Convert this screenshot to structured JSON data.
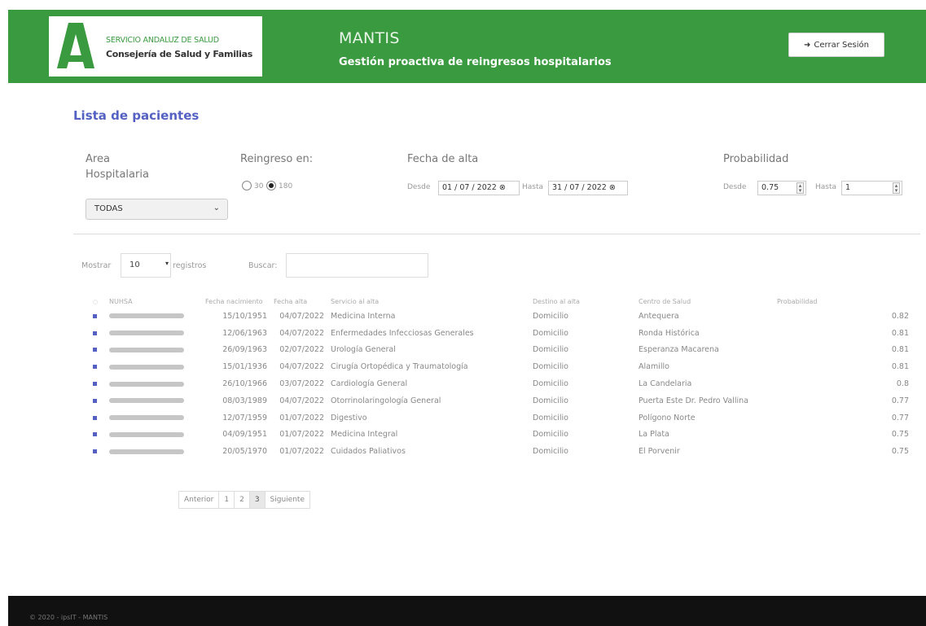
{
  "header": {
    "logo_line1": "SERVICIO ANDALUZ DE SALUD",
    "logo_line2": "Consejería de Salud y Familias",
    "app_title": "MANTIS",
    "app_subtitle": "Gestión proactiva de reingresos hospitalarios",
    "logout_label": "Cerrar Sesión",
    "brand_color": "#3a9a3f"
  },
  "page_title": "Lista de pacientes",
  "filters": {
    "area_label_1": "Area",
    "area_label_2": "Hospitalaria",
    "area_value": "TODAS",
    "reingreso_label": "Reingreso en:",
    "radio_30": "30",
    "radio_180": "180",
    "fecha_label": "Fecha de alta",
    "desde_label": "Desde",
    "desde_value": "01 / 07 / 2022",
    "hasta_label": "Hasta",
    "hasta_value": "31 / 07 / 2022",
    "prob_label": "Probabilidad",
    "prob_desde_label": "Desde",
    "prob_desde_value": "0.75",
    "prob_hasta_label": "Hasta",
    "prob_hasta_value": "1"
  },
  "table_controls": {
    "mostrar": "Mostrar",
    "length_value": "10",
    "registros": "registros",
    "buscar": "Buscar:"
  },
  "table": {
    "headers": [
      "NUHSA",
      "Fecha nacimiento",
      "Fecha alta",
      "Servicio al alta",
      "Destino al alta",
      "Centro de Salud",
      "Probabilidad"
    ],
    "rows": [
      {
        "nacimiento": "15/10/1951",
        "alta": "04/07/2022",
        "servicio": "Medicina Interna",
        "destino": "Domicilio",
        "centro": "Antequera",
        "prob": "0.82"
      },
      {
        "nacimiento": "12/06/1963",
        "alta": "04/07/2022",
        "servicio": "Enfermedades Infecciosas Generales",
        "destino": "Domicilio",
        "centro": "Ronda Histórica",
        "prob": "0.81"
      },
      {
        "nacimiento": "26/09/1963",
        "alta": "02/07/2022",
        "servicio": "Urología General",
        "destino": "Domicilio",
        "centro": "Esperanza Macarena",
        "prob": "0.81"
      },
      {
        "nacimiento": "15/01/1936",
        "alta": "04/07/2022",
        "servicio": "Cirugía Ortopédica y Traumatología",
        "destino": "Domicilio",
        "centro": "Alamillo",
        "prob": "0.81"
      },
      {
        "nacimiento": "26/10/1966",
        "alta": "03/07/2022",
        "servicio": "Cardiología General",
        "destino": "Domicilio",
        "centro": "La Candelaria",
        "prob": "0.8"
      },
      {
        "nacimiento": "08/03/1989",
        "alta": "04/07/2022",
        "servicio": "Otorrinolaringología General",
        "destino": "Domicilio",
        "centro": "Puerta Este Dr. Pedro Vallina",
        "prob": "0.77"
      },
      {
        "nacimiento": "12/07/1959",
        "alta": "01/07/2022",
        "servicio": "Digestivo",
        "destino": "Domicilio",
        "centro": "Polígono Norte",
        "prob": "0.77"
      },
      {
        "nacimiento": "04/09/1951",
        "alta": "01/07/2022",
        "servicio": "Medicina Integral",
        "destino": "Domicilio",
        "centro": "La Plata",
        "prob": "0.75"
      },
      {
        "nacimiento": "20/05/1970",
        "alta": "01/07/2022",
        "servicio": "Cuidados Paliativos",
        "destino": "Domicilio",
        "centro": "El Porvenir",
        "prob": "0.75"
      }
    ]
  },
  "pagination": {
    "prev": "Anterior",
    "pages": [
      "1",
      "2",
      "3"
    ],
    "active_page": "3",
    "next": "Siguiente"
  },
  "footer": {
    "text": "© 2020 - ipsIT - MANTIS"
  }
}
